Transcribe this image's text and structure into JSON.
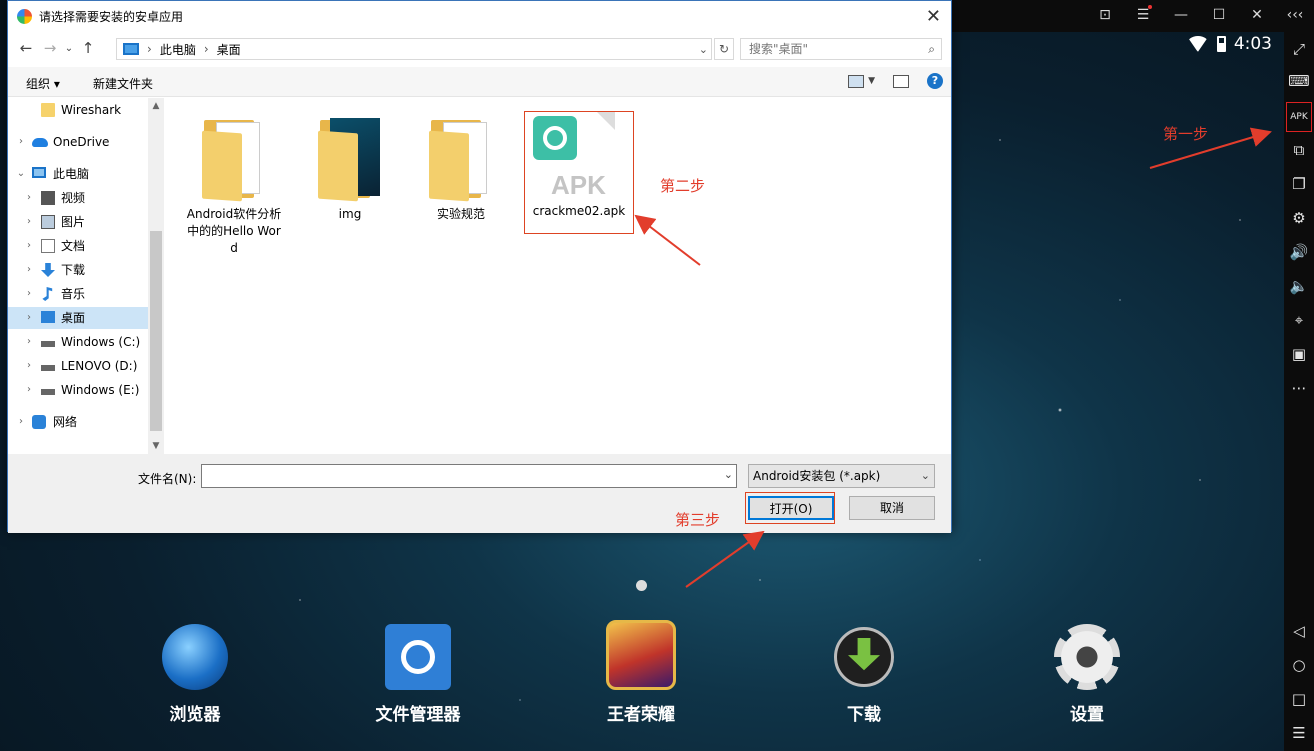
{
  "dialog": {
    "title": "请选择需要安装的安卓应用",
    "breadcrumb": [
      "此电脑",
      "桌面"
    ],
    "search_placeholder": "搜索\"桌面\"",
    "cmd_organize": "组织 ▾",
    "cmd_new_folder": "新建文件夹",
    "tree": [
      {
        "label": "Wireshark",
        "icon": "folder-icon"
      },
      {
        "label": "OneDrive",
        "icon": "cloud-icon"
      },
      {
        "label": "此电脑",
        "icon": "pc-icon"
      },
      {
        "label": "视频",
        "icon": "video-icon"
      },
      {
        "label": "图片",
        "icon": "picture-icon"
      },
      {
        "label": "文档",
        "icon": "document-icon"
      },
      {
        "label": "下载",
        "icon": "download-icon"
      },
      {
        "label": "音乐",
        "icon": "music-icon"
      },
      {
        "label": "桌面",
        "icon": "desktop-icon"
      },
      {
        "label": "Windows (C:)",
        "icon": "drive-icon"
      },
      {
        "label": "LENOVO (D:)",
        "icon": "drive-icon"
      },
      {
        "label": "Windows (E:)",
        "icon": "drive-icon"
      },
      {
        "label": "网络",
        "icon": "network-icon"
      }
    ],
    "files": [
      {
        "name": "Android软件分析中的的Hello Word"
      },
      {
        "name": "img"
      },
      {
        "name": "实验规范"
      },
      {
        "name": "crackme02.apk",
        "badge": "APK"
      }
    ],
    "filename_label": "文件名(N):",
    "filename_value": "",
    "filetype": "Android安装包 (*.apk)",
    "open_button": "打开(O)",
    "cancel_button": "取消"
  },
  "annotations": {
    "step1": "第一步",
    "step2": "第二步",
    "step3": "第三步"
  },
  "emulator": {
    "time": "4:03",
    "apps": [
      {
        "label": "浏览器"
      },
      {
        "label": "文件管理器"
      },
      {
        "label": "王者荣耀"
      },
      {
        "label": "下载"
      },
      {
        "label": "设置"
      }
    ],
    "apk_button": "APK",
    "colors": {
      "annotation": "#e23d2c",
      "accent": "#0078d7"
    }
  }
}
